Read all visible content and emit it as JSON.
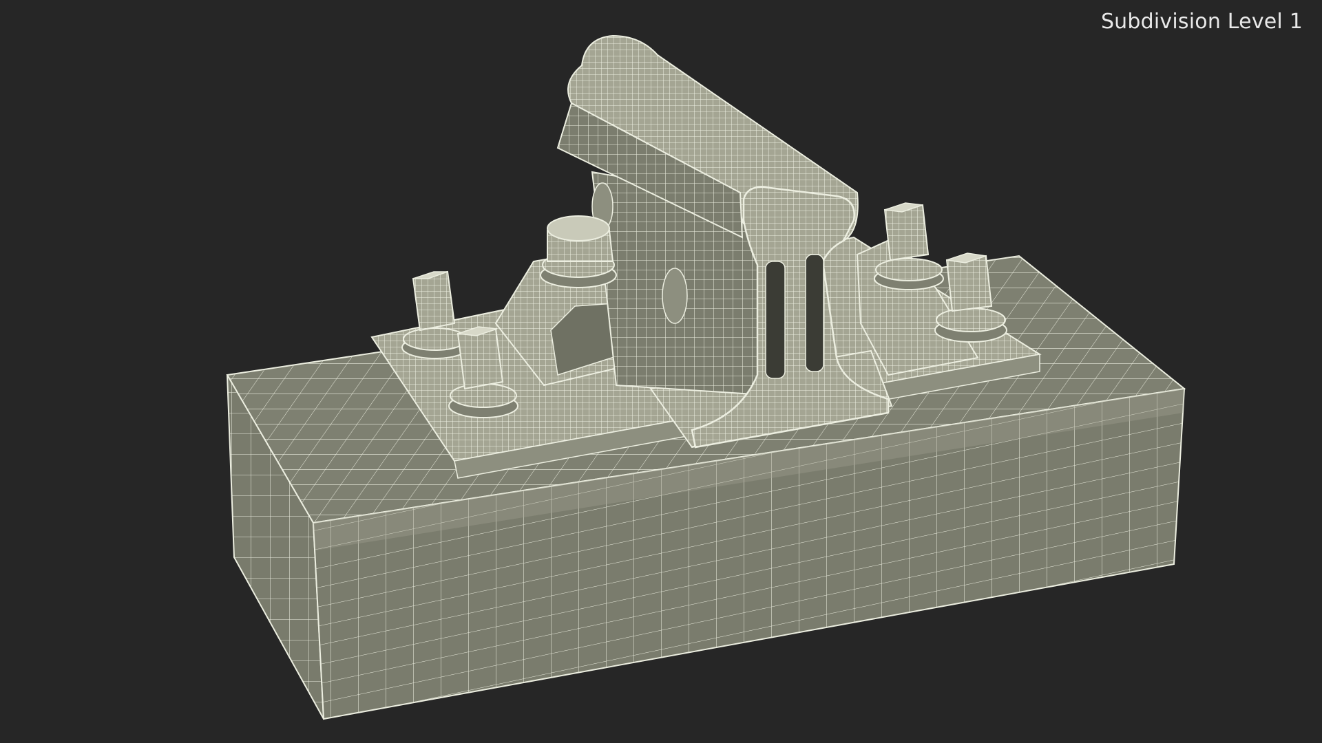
{
  "viewport": {
    "subdivision_label": "Subdivision Level 1"
  },
  "colors": {
    "background": "#262626",
    "surface_fill": "#7b7d6e",
    "surface_fill_light": "#a7a897",
    "wire": "#eceee0",
    "shadow": "#5e6053"
  }
}
